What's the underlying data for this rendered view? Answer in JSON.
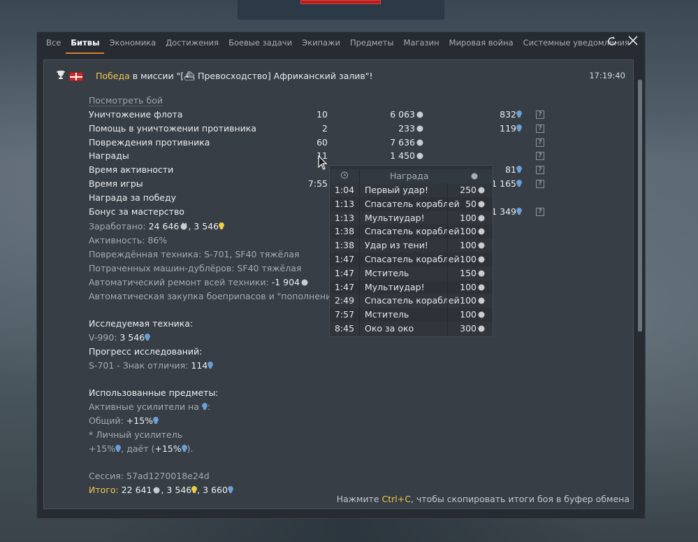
{
  "tabs": [
    {
      "label": "Все",
      "active": false
    },
    {
      "label": "Битвы",
      "active": true
    },
    {
      "label": "Экономика",
      "active": false
    },
    {
      "label": "Достижения",
      "active": false
    },
    {
      "label": "Боевые задачи",
      "active": false
    },
    {
      "label": "Экипажи",
      "active": false
    },
    {
      "label": "Предметы",
      "active": false
    },
    {
      "label": "Магазин",
      "active": false
    },
    {
      "label": "Мировая война",
      "active": false
    },
    {
      "label": "Системные уведомления",
      "active": false
    }
  ],
  "icons": {
    "refresh": "refresh-icon",
    "close": "close-icon"
  },
  "header": {
    "victory": "Победа",
    "rest": " в миссии \"[⛴ Превосходство] Африканский залив\"!",
    "time": "17:19:40"
  },
  "view_battle": "Посмотреть бой",
  "stats": [
    {
      "label": "Уничтожение флота",
      "count": "10",
      "silver": "6 063",
      "rp": "832",
      "help": true
    },
    {
      "label": "Помощь в уничтожении противника",
      "count": "2",
      "silver": "233",
      "rp": "119",
      "help": true
    },
    {
      "label": "Повреждения противника",
      "count": "60",
      "silver": "7 636",
      "rp": "",
      "help": true
    },
    {
      "label": "Награды",
      "count": "11",
      "silver": "1 450",
      "rp": "",
      "help": true
    },
    {
      "label": "Время активности",
      "count": "",
      "silver": "",
      "rp": "81",
      "help": true
    },
    {
      "label": "Время игры",
      "count": "7:55",
      "silver": "",
      "rp": "1 165",
      "help": true
    },
    {
      "label": "Награда за победу",
      "count": "",
      "silver": "",
      "rp": "",
      "help": false
    },
    {
      "label": "Бонус за мастерство",
      "count": "",
      "silver": "",
      "rp": "1 349",
      "help": true
    }
  ],
  "summary": {
    "earned_label": "Заработано: ",
    "earned_silver": "24 646",
    "earned_rp": "3 546",
    "activity": "Активность: 86%",
    "damaged_label": "Повреждённая техника: ",
    "damaged_value": "S-701, SF40 тяжёлая",
    "backup_label": "Потраченных машин-дублёров: ",
    "backup_value": "SF40 тяжёлая",
    "repair_label": "Автоматический ремонт всей техники: ",
    "repair_value": "-1 904",
    "ammo": "Автоматическая закупка боеприпасов и \"пополнения эк",
    "research_title": "Исследуемая техника:",
    "research_vehicle": "V-990: ",
    "research_rp": "3 546",
    "progress_title": "Прогресс исследований:",
    "progress_label": "S-701 - Знак отличия: ",
    "progress_value": "114",
    "items_title": "Использованные предметы:",
    "boosters_label": "Активные усилители на ",
    "boosters_suffix": ":",
    "general_label": "Общий: ",
    "general_value": "+15%",
    "personal": "* Личный усилитель",
    "personal_value": "+15%",
    "personal_mid": ", даёт (",
    "personal_value2": "+15%",
    "personal_end": ").",
    "session": "Сессия: 57ad1270018e24d",
    "total_label": "Итого: ",
    "total_silver": "22 641",
    "total_rp1": "3 546",
    "total_rp2": "3 660"
  },
  "footer_hint": {
    "pre": "Нажмите ",
    "key": "Ctrl+C",
    "post": ", чтобы скопировать итоги боя в буфер обмена"
  },
  "tooltip": {
    "header_name": "Награда",
    "rows": [
      {
        "time": "1:04",
        "name": "Первый удар!",
        "value": "250"
      },
      {
        "time": "1:13",
        "name": "Спасатель кораблей",
        "value": "50"
      },
      {
        "time": "1:13",
        "name": "Мультиудар!",
        "value": "100"
      },
      {
        "time": "1:38",
        "name": "Спасатель кораблей",
        "value": "100"
      },
      {
        "time": "1:38",
        "name": "Удар из тени!",
        "value": "100"
      },
      {
        "time": "1:47",
        "name": "Спасатель кораблей",
        "value": "100"
      },
      {
        "time": "1:47",
        "name": "Мститель",
        "value": "150"
      },
      {
        "time": "1:47",
        "name": "Мультиудар!",
        "value": "100"
      },
      {
        "time": "2:49",
        "name": "Спасатель кораблей",
        "value": "100"
      },
      {
        "time": "7:57",
        "name": "Мститель",
        "value": "100"
      },
      {
        "time": "8:45",
        "name": "Око за око",
        "value": "300"
      }
    ]
  },
  "colors": {
    "accent_orange": "#d8802c",
    "highlight_yellow": "#f0c850",
    "rp_blue": "#6aa0d8"
  }
}
